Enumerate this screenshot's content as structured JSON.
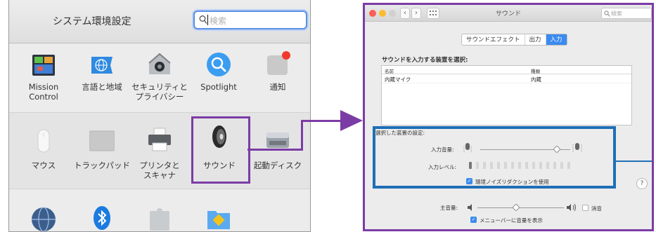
{
  "left_window": {
    "title": "システム環境設定",
    "search_placeholder": "検索",
    "row1": [
      {
        "label": "Mission\nControl",
        "icon": "mission-control-icon"
      },
      {
        "label": "言語と地域",
        "icon": "globe-flag-icon"
      },
      {
        "label": "セキュリティと\nプライバシー",
        "icon": "house-lock-icon"
      },
      {
        "label": "Spotlight",
        "icon": "magnifier-icon"
      },
      {
        "label": "通知",
        "icon": "notifications-icon"
      }
    ],
    "row2": [
      {
        "label": "マウス",
        "icon": "mouse-icon"
      },
      {
        "label": "トラックパッド",
        "icon": "trackpad-icon"
      },
      {
        "label": "プリンタと\nスキャナ",
        "icon": "printer-icon"
      },
      {
        "label": "サウンド",
        "icon": "speaker-icon"
      },
      {
        "label": "起動ディスク",
        "icon": "disk-icon"
      }
    ],
    "row3": [
      {
        "label": "",
        "icon": "network-globe-icon"
      },
      {
        "label": "",
        "icon": "bluetooth-icon"
      },
      {
        "label": "",
        "icon": "extensions-icon"
      },
      {
        "label": "",
        "icon": "sharing-folder-icon"
      }
    ]
  },
  "right_window": {
    "title": "サウンド",
    "search_placeholder": "検索",
    "tabs": [
      {
        "label": "サウンドエフェクト",
        "active": false
      },
      {
        "label": "出力",
        "active": false
      },
      {
        "label": "入力",
        "active": true
      }
    ],
    "device_heading": "サウンドを入力する装置を選択:",
    "table": {
      "headers": [
        "名前",
        "種類"
      ],
      "rows": [
        [
          "内蔵マイク",
          "内蔵"
        ]
      ]
    },
    "settings_title": "選択した装置の設定:",
    "input_volume_label": "入力音量:",
    "input_volume": 0.85,
    "input_level_label": "入力レベル:",
    "input_level": 0.07,
    "noise_reduction_label": "環境ノイズリダクションを使用",
    "noise_reduction_checked": true,
    "master_volume_label": "主音量:",
    "master_volume": 0.45,
    "mute_label": "消音",
    "mute_checked": false,
    "menubar_label": "メニューバーに音量を表示",
    "menubar_checked": true,
    "help_label": "?"
  },
  "colors": {
    "highlight_purple": "#7b3ca5",
    "highlight_blue": "#1f6fb5",
    "accent_blue": "#3b8bef"
  }
}
